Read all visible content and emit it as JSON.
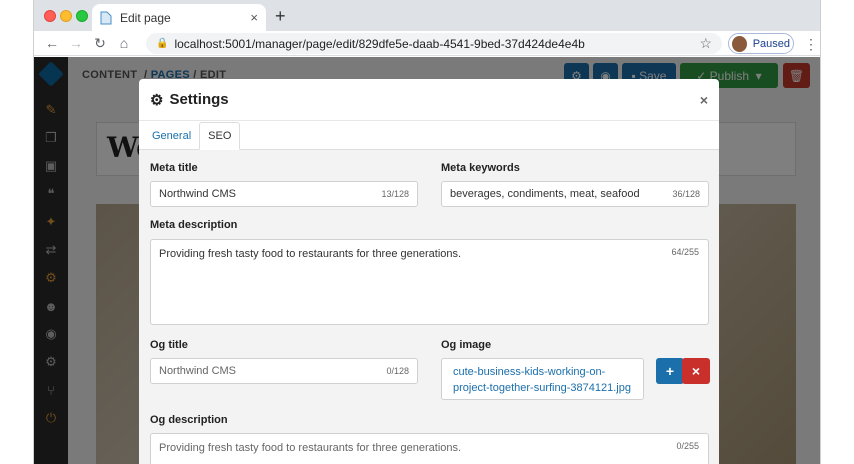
{
  "browser": {
    "tab_title": "Edit page",
    "tab_close": "×",
    "new_tab": "+",
    "url": "localhost:5001/manager/page/edit/829dfe5e-daab-4541-9bed-37d424de4e4b",
    "profile_label": "Paused"
  },
  "app": {
    "breadcrumb": {
      "content": "CONTENT",
      "sep1": "/",
      "pages": "PAGES",
      "sep2": "/",
      "edit": "EDIT"
    },
    "buttons": {
      "save": "Save",
      "publish": "Publish"
    },
    "page_title_preview": "We"
  },
  "modal": {
    "title": "Settings",
    "close": "×",
    "tabs": [
      {
        "label": "General"
      },
      {
        "label": "SEO"
      }
    ],
    "meta_title": {
      "label": "Meta title",
      "value": "Northwind CMS",
      "counter": "13/128"
    },
    "meta_keywords": {
      "label": "Meta keywords",
      "value": "beverages, condiments, meat, seafood",
      "counter": "36/128"
    },
    "meta_description": {
      "label": "Meta description",
      "value": "Providing fresh tasty food to restaurants for three generations.",
      "counter": "64/255"
    },
    "og_title": {
      "label": "Og title",
      "placeholder": "Northwind CMS",
      "counter": "0/128"
    },
    "og_image": {
      "label": "Og image",
      "value": "cute-business-kids-working-on-project-together-surfing-3874121.jpg",
      "add": "+",
      "remove": "×"
    },
    "og_description": {
      "label": "Og description",
      "placeholder": "Providing fresh tasty food to restaurants for three generations.",
      "counter": "0/255"
    }
  },
  "colors": {
    "link": "#1b6fab",
    "publish": "#2f9a42",
    "delete": "#c0392b",
    "primary": "#1b6fab",
    "danger": "#c9302c"
  }
}
